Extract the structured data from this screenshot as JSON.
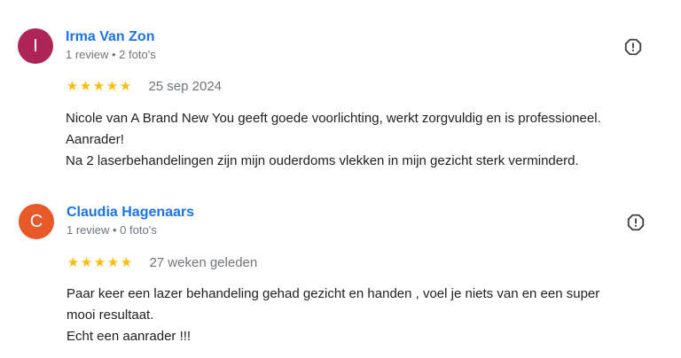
{
  "reviews": [
    {
      "initial": "I",
      "avatar_color": "#ad2455",
      "author": "Irma Van Zon",
      "meta": "1 review • 2 foto's",
      "rating": 5,
      "star_glyph": "★",
      "date": "25 sep 2024",
      "text_lines": [
        "Nicole van A Brand New You geeft goede voorlichting, werkt zorgvuldig en is professioneel.",
        "Aanrader!",
        "Na 2 laserbehandelingen zijn mijn ouderdoms vlekken in mijn gezicht sterk verminderd."
      ],
      "flag_icon": "report-flag-icon"
    },
    {
      "initial": "C",
      "avatar_color": "#e8592a",
      "author": "Claudia Hagenaars",
      "meta": "1 review • 0 foto's",
      "rating": 5,
      "star_glyph": "★",
      "date": "27 weken geleden",
      "text_lines": [
        "Paar keer een lazer behandeling gehad gezicht en handen , voel je niets van en een super",
        "mooi resultaat.",
        "Echt een aanrader !!!"
      ],
      "flag_icon": "report-flag-icon"
    }
  ],
  "colors": {
    "author_link": "#1a73e8",
    "star": "#fbbc04",
    "meta_text": "#70757a",
    "body_text": "#202124"
  }
}
